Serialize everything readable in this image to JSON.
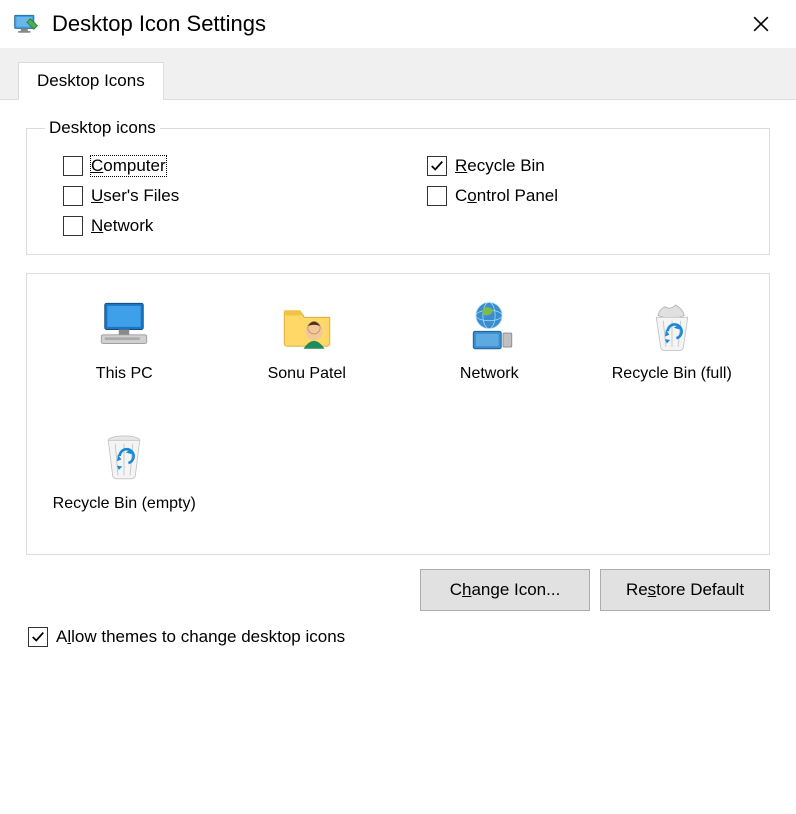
{
  "window": {
    "title": "Desktop Icon Settings"
  },
  "tabs": {
    "desktop_icons": "Desktop Icons"
  },
  "group": {
    "legend": "Desktop icons",
    "items": [
      {
        "label_pre": "",
        "accel": "C",
        "label_post": "omputer",
        "checked": false,
        "focused": true
      },
      {
        "label_pre": "",
        "accel": "R",
        "label_post": "ecycle Bin",
        "checked": true,
        "focused": false
      },
      {
        "label_pre": "",
        "accel": "U",
        "label_post": "ser's Files",
        "checked": false,
        "focused": false
      },
      {
        "label_pre": "C",
        "accel": "o",
        "label_post": "ntrol Panel",
        "checked": false,
        "focused": false
      },
      {
        "label_pre": "",
        "accel": "N",
        "label_post": "etwork",
        "checked": false,
        "focused": false
      }
    ]
  },
  "icons": [
    {
      "name": "this-pc",
      "label": "This PC"
    },
    {
      "name": "user-folder",
      "label": "Sonu Patel"
    },
    {
      "name": "network",
      "label": "Network"
    },
    {
      "name": "recycle-full",
      "label": "Recycle Bin (full)"
    },
    {
      "name": "recycle-empty",
      "label": "Recycle Bin (empty)"
    }
  ],
  "buttons": {
    "change_pre": "C",
    "change_accel": "h",
    "change_post": "ange Icon...",
    "restore_pre": "Re",
    "restore_accel": "s",
    "restore_post": "tore Default"
  },
  "allow_themes": {
    "pre": "A",
    "accel": "l",
    "post": "low themes to change desktop icons",
    "checked": true
  }
}
